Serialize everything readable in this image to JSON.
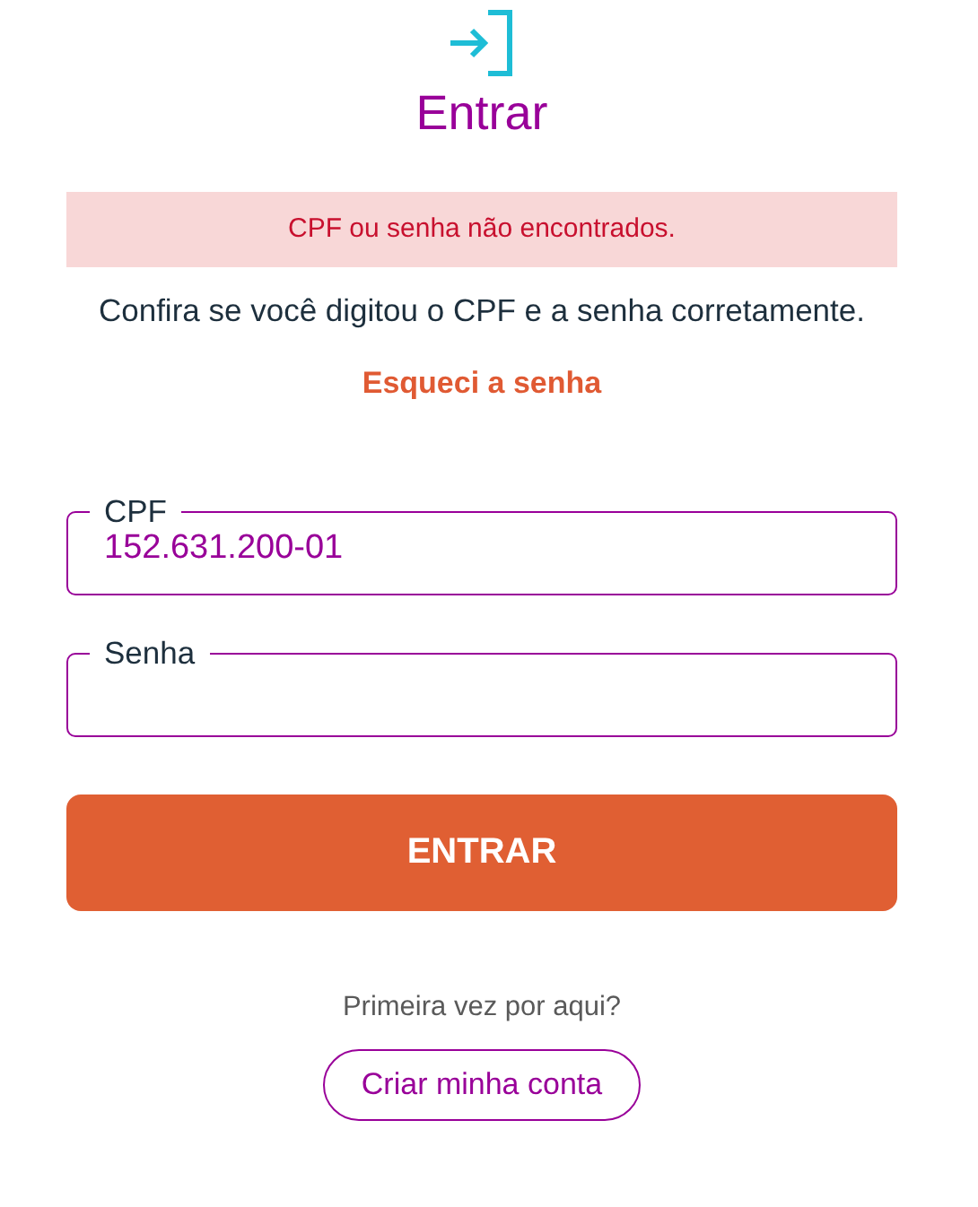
{
  "title": "Entrar",
  "error": "CPF ou senha não encontrados.",
  "hint": "Confira se você digitou o CPF e a senha corretamente.",
  "forgot_link": "Esqueci a senha",
  "fields": [
    {
      "label": "CPF",
      "value": "152.631.200-01"
    },
    {
      "label": "Senha"
    }
  ],
  "submit_button": "ENTRAR",
  "signup_prompt": "Primeira vez por aqui?",
  "signup_button": "Criar minha conta"
}
